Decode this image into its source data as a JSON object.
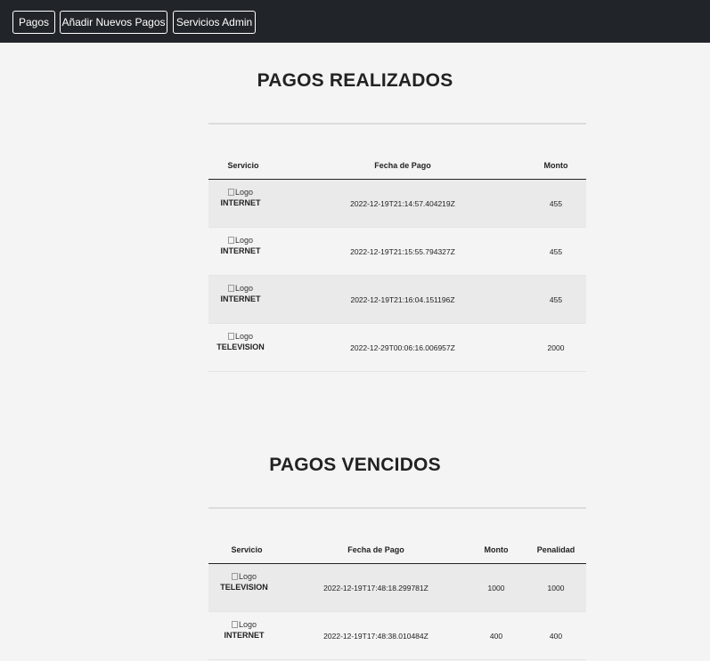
{
  "nav": {
    "pagos": "Pagos",
    "anadir": "Añadir Nuevos Pagos",
    "servicios_admin": "Servicios Admin"
  },
  "realizados": {
    "title": "PAGOS REALIZADOS",
    "headers": {
      "servicio": "Servicio",
      "fecha": "Fecha de Pago",
      "monto": "Monto"
    },
    "rows": [
      {
        "logo_alt": "Logo",
        "service": "INTERNET",
        "date": "2022-12-19T21:14:57.404219Z",
        "amount": "455"
      },
      {
        "logo_alt": "Logo",
        "service": "INTERNET",
        "date": "2022-12-19T21:15:55.794327Z",
        "amount": "455"
      },
      {
        "logo_alt": "Logo",
        "service": "INTERNET",
        "date": "2022-12-19T21:16:04.151196Z",
        "amount": "455"
      },
      {
        "logo_alt": "Logo",
        "service": "TELEVISION",
        "date": "2022-12-29T00:06:16.006957Z",
        "amount": "2000"
      }
    ]
  },
  "vencidos": {
    "title": "PAGOS VENCIDOS",
    "headers": {
      "servicio": "Servicio",
      "fecha": "Fecha de Pago",
      "monto": "Monto",
      "penalidad": "Penalidad"
    },
    "rows": [
      {
        "logo_alt": "Logo",
        "service": "TELEVISION",
        "date": "2022-12-19T17:48:18.299781Z",
        "amount": "1000",
        "penalty": "1000"
      },
      {
        "logo_alt": "Logo",
        "service": "INTERNET",
        "date": "2022-12-19T17:48:38.010484Z",
        "amount": "400",
        "penalty": "400"
      }
    ]
  }
}
